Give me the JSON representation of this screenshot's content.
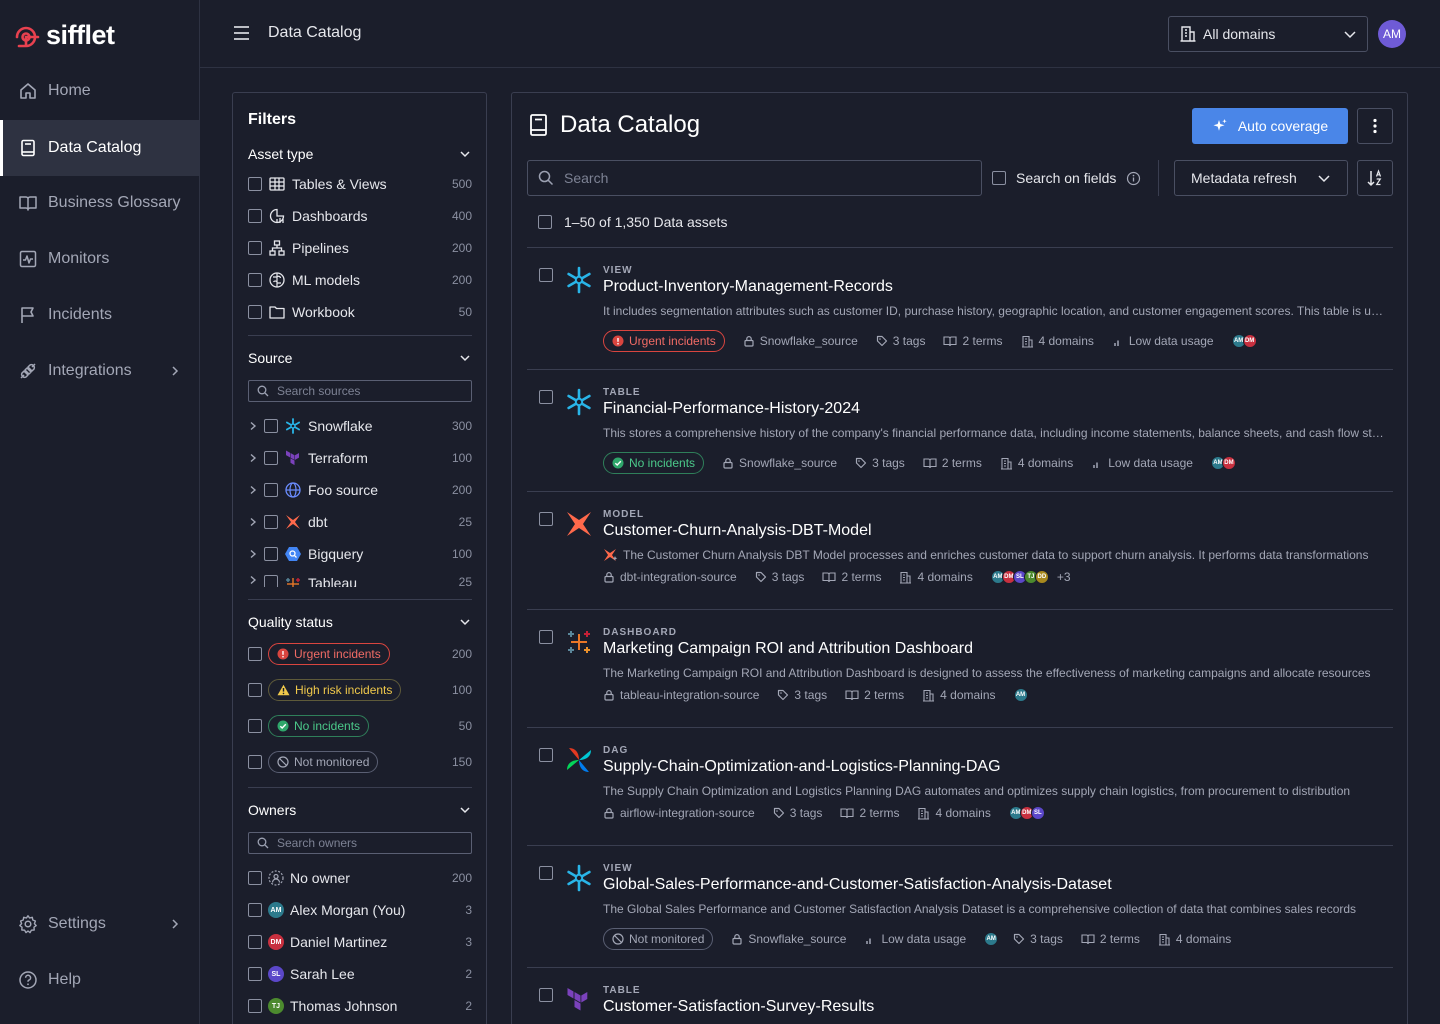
{
  "brand": {
    "name": "sifflet"
  },
  "nav": {
    "items": [
      {
        "label": "Home"
      },
      {
        "label": "Data Catalog"
      },
      {
        "label": "Business Glossary"
      },
      {
        "label": "Monitors"
      },
      {
        "label": "Incidents"
      },
      {
        "label": "Integrations"
      }
    ],
    "settings": "Settings",
    "help": "Help"
  },
  "topbar": {
    "title": "Data Catalog",
    "domain": "All domains",
    "user_initials": "AM"
  },
  "filters": {
    "title": "Filters",
    "asset_type": {
      "label": "Asset type",
      "items": [
        {
          "label": "Tables & Views",
          "count": "500"
        },
        {
          "label": "Dashboards",
          "count": "400"
        },
        {
          "label": "Pipelines",
          "count": "200"
        },
        {
          "label": "ML models",
          "count": "200"
        },
        {
          "label": "Workbook",
          "count": "50"
        }
      ]
    },
    "source": {
      "label": "Source",
      "placeholder": "Search sources",
      "items": [
        {
          "label": "Snowflake",
          "count": "300"
        },
        {
          "label": "Terraform",
          "count": "100"
        },
        {
          "label": "Foo source",
          "count": "200"
        },
        {
          "label": "dbt",
          "count": "25"
        },
        {
          "label": "Bigquery",
          "count": "100"
        },
        {
          "label": "Tableau",
          "count": "25"
        }
      ]
    },
    "quality": {
      "label": "Quality status",
      "items": [
        {
          "label": "Urgent incidents",
          "count": "200"
        },
        {
          "label": "High risk incidents",
          "count": "100"
        },
        {
          "label": "No incidents",
          "count": "50"
        },
        {
          "label": "Not monitored",
          "count": "150"
        }
      ]
    },
    "owners": {
      "label": "Owners",
      "placeholder": "Search owners",
      "items": [
        {
          "label": "No owner",
          "count": "200",
          "initials": ""
        },
        {
          "label": "Alex Morgan (You)",
          "count": "3",
          "initials": "AM"
        },
        {
          "label": "Daniel Martinez",
          "count": "3",
          "initials": "DM"
        },
        {
          "label": "Sarah Lee",
          "count": "2",
          "initials": "SL"
        },
        {
          "label": "Thomas Johnson",
          "count": "2",
          "initials": "TJ"
        }
      ]
    }
  },
  "catalog": {
    "title": "Data Catalog",
    "auto_coverage": "Auto coverage",
    "search_placeholder": "Search",
    "search_on_fields": "Search on fields",
    "metadata_refresh": "Metadata refresh",
    "count_label": "1–50 of 1,350 Data assets",
    "rows": [
      {
        "type": "VIEW",
        "name": "Product-Inventory-Management-Records",
        "desc": "It includes segmentation attributes such as customer ID, purchase history, geographic location, and customer engagement scores. This table is used for marketing",
        "status": "Urgent incidents",
        "source": "Snowflake_source",
        "tags": "3 tags",
        "terms": "2 terms",
        "domains": "4 domains",
        "usage": "Low data usage",
        "owners": [
          "AM",
          "DM"
        ]
      },
      {
        "type": "TABLE",
        "name": "Financial-Performance-History-2024",
        "desc": "This stores a comprehensive history of the company's financial performance data, including income statements, balance sheets, and cash flow statements",
        "status": "No incidents",
        "source": "Snowflake_source",
        "tags": "3 tags",
        "terms": "2 terms",
        "domains": "4 domains",
        "usage": "Low data usage",
        "owners": [
          "AM",
          "DM"
        ]
      },
      {
        "type": "MODEL",
        "name": "Customer-Churn-Analysis-DBT-Model",
        "desc": "The Customer Churn Analysis DBT Model processes and enriches customer data to support churn analysis. It performs data transformations",
        "source": "dbt-integration-source",
        "tags": "3 tags",
        "terms": "2 terms",
        "domains": "4 domains",
        "owners": [
          "AM",
          "DM",
          "SL",
          "TJ",
          "DD"
        ],
        "owners_more": "+3"
      },
      {
        "type": "DASHBOARD",
        "name": "Marketing Campaign ROI and Attribution Dashboard",
        "desc": "The Marketing Campaign ROI and Attribution Dashboard is designed to assess the effectiveness of marketing campaigns and allocate resources",
        "source": "tableau-integration-source",
        "tags": "3 tags",
        "terms": "2 terms",
        "domains": "4 domains",
        "owners": [
          "AM"
        ]
      },
      {
        "type": "DAG",
        "name": "Supply-Chain-Optimization-and-Logistics-Planning-DAG",
        "desc": "The Supply Chain Optimization and Logistics Planning DAG automates and optimizes supply chain logistics, from procurement to distribution",
        "source": "airflow-integration-source",
        "tags": "3 tags",
        "terms": "2 terms",
        "domains": "4 domains",
        "owners": [
          "AM",
          "DM",
          "SL"
        ]
      },
      {
        "type": "VIEW",
        "name": "Global-Sales-Performance-and-Customer-Satisfaction-Analysis-Dataset",
        "desc": "The Global Sales Performance and Customer Satisfaction Analysis Dataset is a comprehensive collection of data that combines sales records",
        "status": "Not monitored",
        "source": "Snowflake_source",
        "usage": "Low data usage",
        "owners": [
          "AM"
        ],
        "tags": "3 tags",
        "terms": "2 terms",
        "domains": "4 domains"
      },
      {
        "type": "TABLE",
        "name": "Customer-Satisfaction-Survey-Results"
      }
    ]
  },
  "colors": {
    "accent": "#4a86e8",
    "brand": "#e8414f",
    "bg": "#1b1e2b",
    "urgent": "#d9453f",
    "success": "#4bc98a",
    "warning": "#f0c94b"
  }
}
